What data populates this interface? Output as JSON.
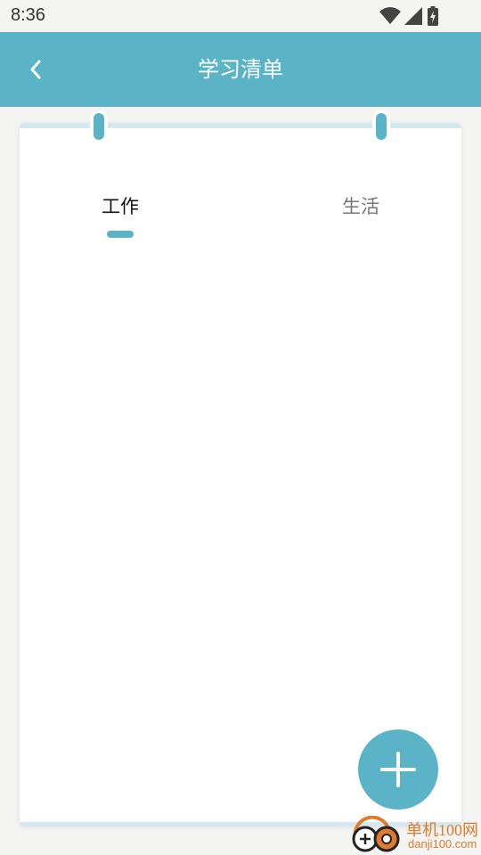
{
  "status_bar": {
    "time": "8:36",
    "icons": [
      "wifi-icon",
      "cell-signal-icon",
      "battery-charging-icon"
    ]
  },
  "app_bar": {
    "title": "学习清单",
    "back_icon": "chevron-left-icon",
    "color": "#5bb3c8"
  },
  "tabs": [
    {
      "label": "工作",
      "selected": true
    },
    {
      "label": "生活",
      "selected": false
    }
  ],
  "fab": {
    "icon": "plus-icon"
  },
  "watermark": {
    "brand": "单机100网",
    "domain": "danji100.com"
  },
  "colors": {
    "accent": "#5bb3c8",
    "watermark": "#e07a2c"
  }
}
